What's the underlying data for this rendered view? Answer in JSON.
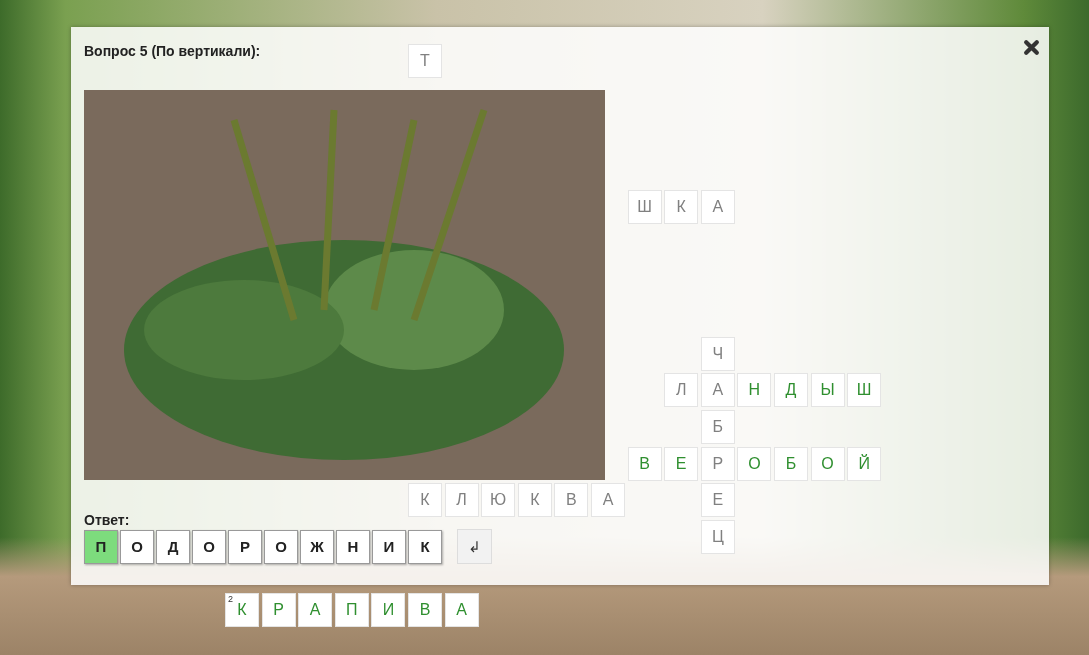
{
  "crossword": {
    "cells": [
      {
        "letter": "Т",
        "solved": false
      },
      {
        "letter": "Ш",
        "solved": false
      },
      {
        "letter": "К",
        "solved": false
      },
      {
        "letter": "А",
        "solved": false
      },
      {
        "letter": "Ч",
        "solved": false
      },
      {
        "letter": "Л",
        "solved": false
      },
      {
        "letter": "А",
        "solved": false
      },
      {
        "letter": "Н",
        "solved": true
      },
      {
        "letter": "Д",
        "solved": true
      },
      {
        "letter": "Ы",
        "solved": true
      },
      {
        "letter": "Ш",
        "solved": true
      },
      {
        "letter": "Б",
        "solved": false
      },
      {
        "letter": "В",
        "solved": true
      },
      {
        "letter": "Е",
        "solved": true
      },
      {
        "letter": "Р",
        "solved": false
      },
      {
        "letter": "О",
        "solved": true
      },
      {
        "letter": "Б",
        "solved": true
      },
      {
        "letter": "О",
        "solved": true
      },
      {
        "letter": "Й",
        "solved": true
      },
      {
        "letter": "К",
        "solved": false
      },
      {
        "letter": "Л",
        "solved": false
      },
      {
        "letter": "Ю",
        "solved": false
      },
      {
        "letter": "К",
        "solved": false
      },
      {
        "letter": "В",
        "solved": false
      },
      {
        "letter": "А",
        "solved": false
      },
      {
        "letter": "Е",
        "solved": false
      },
      {
        "letter": "Ц",
        "solved": false
      },
      {
        "letter": "К",
        "solved": true,
        "number": "2"
      },
      {
        "letter": "Р",
        "solved": true
      },
      {
        "letter": "А",
        "solved": true
      },
      {
        "letter": "П",
        "solved": true
      },
      {
        "letter": "И",
        "solved": true
      },
      {
        "letter": "В",
        "solved": true
      },
      {
        "letter": "А",
        "solved": true
      }
    ]
  },
  "dialog": {
    "title": "Вопрос 5 (По вертикали):",
    "answer_label": "Ответ:",
    "answer": [
      {
        "letter": "П",
        "selected": true
      },
      {
        "letter": "О",
        "selected": false
      },
      {
        "letter": "Д",
        "selected": false
      },
      {
        "letter": "О",
        "selected": false
      },
      {
        "letter": "Р",
        "selected": false
      },
      {
        "letter": "О",
        "selected": false
      },
      {
        "letter": "Ж",
        "selected": false
      },
      {
        "letter": "Н",
        "selected": false
      },
      {
        "letter": "И",
        "selected": false
      },
      {
        "letter": "К",
        "selected": false
      }
    ],
    "submit": "↲"
  }
}
